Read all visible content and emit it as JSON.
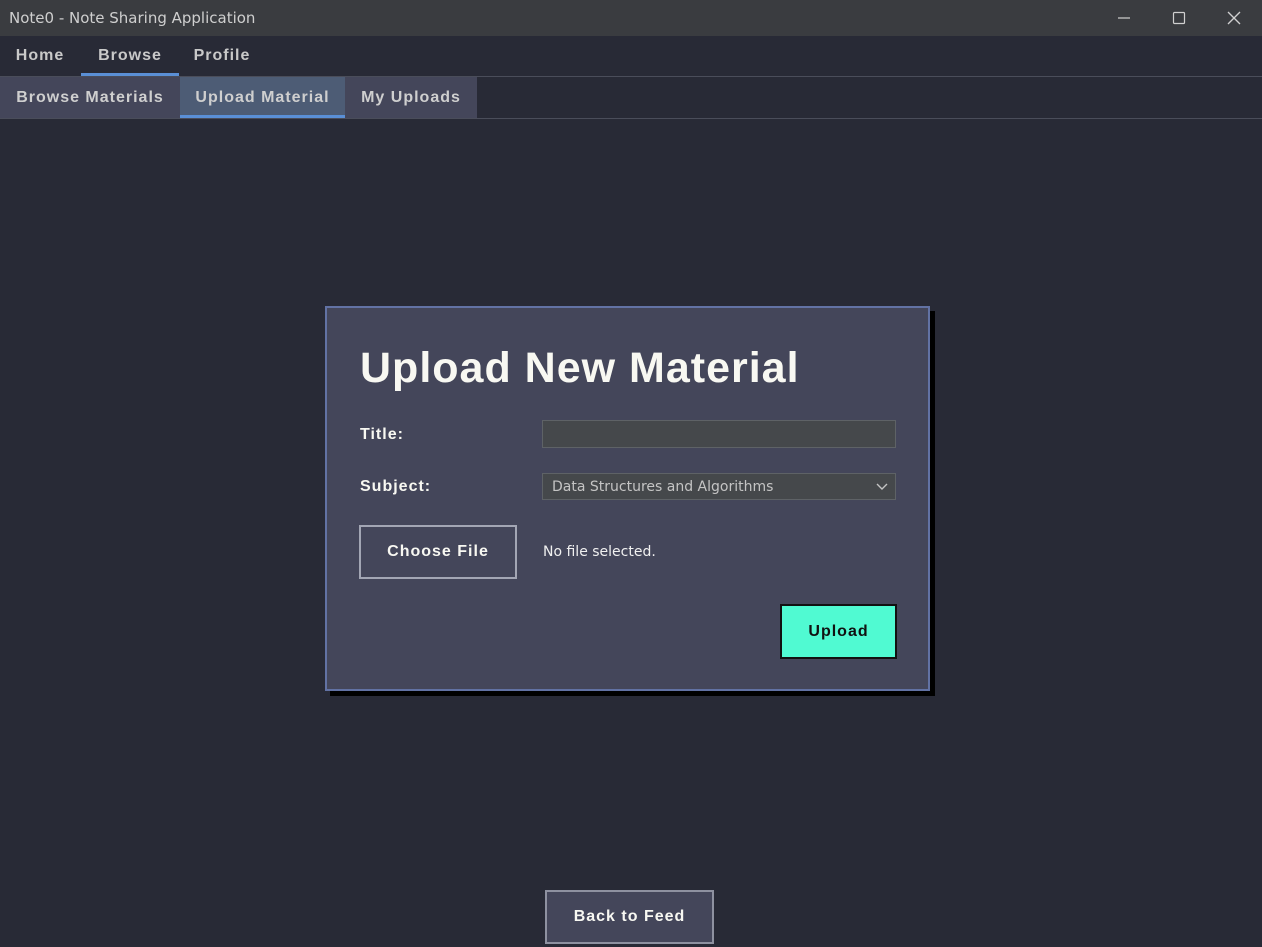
{
  "window": {
    "title": "Note0 - Note Sharing Application"
  },
  "menu": {
    "items": [
      {
        "label": "Home",
        "active": false
      },
      {
        "label": "Browse",
        "active": true
      },
      {
        "label": "Profile",
        "active": false
      }
    ]
  },
  "tabs": {
    "items": [
      {
        "label": "Browse Materials",
        "active": false
      },
      {
        "label": "Upload Material",
        "active": true
      },
      {
        "label": "My Uploads",
        "active": false
      }
    ]
  },
  "upload_form": {
    "heading": "Upload New Material",
    "title_label": "Title:",
    "title_value": "",
    "subject_label": "Subject:",
    "subject_selected": "Data Structures and Algorithms",
    "choose_file_label": "Choose File",
    "file_status": "No file selected.",
    "upload_label": "Upload"
  },
  "footer": {
    "back_label": "Back to Feed"
  },
  "colors": {
    "background": "#282a36",
    "card": "#44465a",
    "card_border": "#6272a4",
    "accent": "#5a8fd6",
    "upload_button": "#50fad2"
  },
  "icons": {
    "minimize": "minimize-icon",
    "maximize": "maximize-icon",
    "close": "close-icon",
    "dropdown": "chevron-down-icon"
  }
}
